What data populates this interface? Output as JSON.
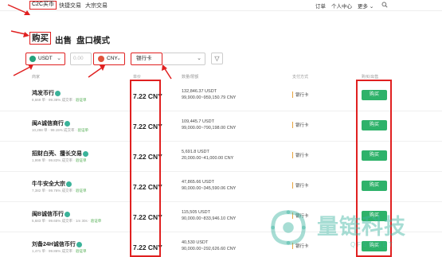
{
  "topbar": {
    "tabs": [
      "C2C买币",
      "快捷交易",
      "大宗交易"
    ],
    "right_links": [
      "订单",
      "个人中心",
      "更多"
    ]
  },
  "subtabs": [
    "购买",
    "出售",
    "盘口模式"
  ],
  "filters": {
    "coin": "USDT",
    "amount_placeholder": "0.00",
    "currency": "CNY",
    "payment": "银行卡",
    "filter_icon": "funnel-icon"
  },
  "columns": {
    "merchant": "商家",
    "price": "单价",
    "amount": "数量/限额",
    "payment": "支付方式",
    "action": "购买/出售"
  },
  "rows": [
    {
      "name": "鸿发币行",
      "stats": "8,669 单 · 99.38% 成交率 · ",
      "tag": "验证单",
      "price": "7.22 CNY",
      "qty": "132,846.37 USDT",
      "limit": "99,900.00~959,150.79 CNY",
      "pay": "银行卡",
      "btn": "购买"
    },
    {
      "name": "闽A诚信商行",
      "stats": "10,298 单 · 99.15% 成交率 · ",
      "tag": "验证单",
      "price": "7.22 CNY",
      "qty": "109,445.7 USDT",
      "limit": "99,000.00~790,198.00 CNY",
      "pay": "银行卡",
      "btn": "购买"
    },
    {
      "name": "招财白壳、擅长交易",
      "stats": "1,999 单 · 99.83% 成交率 · ",
      "tag": "验证单",
      "price": "7.22 CNY",
      "qty": "5,691.8 USDT",
      "limit": "20,000.00~41,000.00 CNY",
      "pay": "银行卡",
      "btn": "购买"
    },
    {
      "name": "牛牛安全大宗",
      "stats": "7,382 单 · 99.76% 成交率 · ",
      "tag": "验证单",
      "price": "7.22 CNY",
      "qty": "47,865.66 USDT",
      "limit": "90,000.00~345,590.06 CNY",
      "pay": "银行卡",
      "btn": "购买"
    },
    {
      "name": "闽B诚信币行",
      "stats": "5,683 单 · 99.65% 成交率 · 1m 30s · ",
      "tag": "验证单",
      "price": "7.22 CNY",
      "qty": "115,505 USDT",
      "limit": "90,000.00~833,946.10 CNY",
      "pay": "银行卡",
      "btn": "购买"
    },
    {
      "name": "刘备24H诚信币行",
      "stats": "1,471 单 · 99.86% 成交率 · ",
      "tag": "验证单",
      "price": "7.22 CNY",
      "qty": "40,530 USDT",
      "limit": "90,000.00~292,626.60 CNY",
      "pay": "银行卡",
      "btn": "购买"
    }
  ],
  "watermark": {
    "text": "量链科技",
    "url": "QFSP.NET"
  },
  "colors": {
    "accent_red": "#e02020",
    "buy_green": "#2eb26a",
    "verify_teal": "#3bb39a",
    "watermark": "#3cb4a0"
  }
}
